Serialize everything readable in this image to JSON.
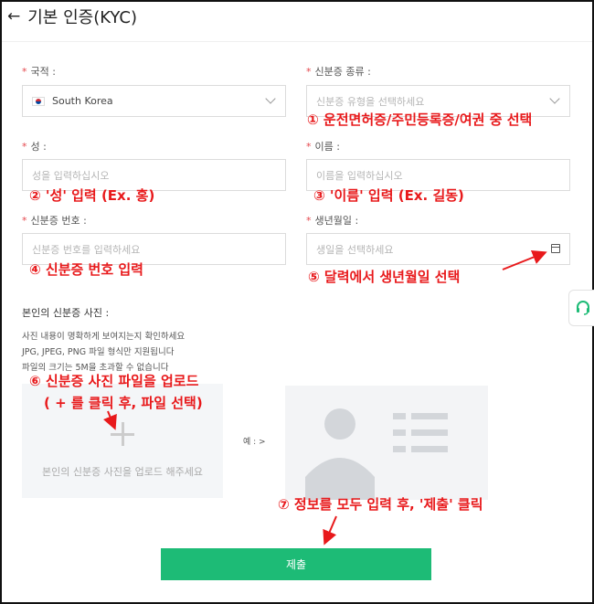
{
  "header": {
    "back_icon": "←",
    "title": "기본 인증(KYC)"
  },
  "form": {
    "nationality": {
      "required_mark": "*",
      "label": "국적 :",
      "value": "South Korea"
    },
    "id_type": {
      "required_mark": "*",
      "label": "신분증 종류 :",
      "placeholder": "신분증 유형을 선택하세요"
    },
    "last_name": {
      "required_mark": "*",
      "label": "성 :",
      "placeholder": "성을 입력하십시오"
    },
    "first_name": {
      "required_mark": "*",
      "label": "이름 :",
      "placeholder": "이름을 입력하십시오"
    },
    "id_number": {
      "required_mark": "*",
      "label": "신분증 번호 :",
      "placeholder": "신분증 번호를 입력하세요"
    },
    "birth_date": {
      "required_mark": "*",
      "label": "생년월일 :",
      "placeholder": "생일을 선택하세요"
    }
  },
  "photo": {
    "label": "본인의 신분증 사진 :",
    "info_lines": [
      "사진 내용이 명확하게 보여지는지 확인하세요",
      "JPG, JPEG, PNG 파일 형식만 지원됩니다",
      "파일의 크기는 5M을 초과할 수 없습니다"
    ],
    "upload_text": "본인의 신분증 사진을 업로드 해주세요",
    "example_label": "예 : >"
  },
  "submit_label": "제출",
  "annotations": {
    "a1": "① 운전면허증/주민등록증/여권 중 선택",
    "a2": "② '성' 입력 (Ex. 홍)",
    "a3": "③ '이름' 입력 (Ex. 길동)",
    "a4": "④ 신분증 번호 입력",
    "a5": "⑤ 달력에서 생년월일 선택",
    "a6_line1": "⑥ 신분증 사진 파일을 업로드",
    "a6_line2": "( + 를 클릭 후, 파일 선택)",
    "a7": "⑦ 정보를 모두 입력 후, '제출' 클릭"
  },
  "colors": {
    "accent": "#1dbb76",
    "annotation": "#e8191b",
    "required": "#e5484d"
  },
  "icons": {
    "back": "arrow-left-icon",
    "dropdown": "chevron-down-icon",
    "calendar": "calendar-icon",
    "upload": "plus-icon",
    "help": "headset-icon"
  }
}
